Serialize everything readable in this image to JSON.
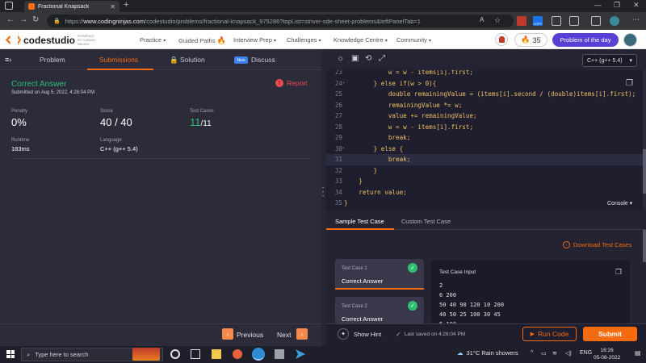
{
  "browser": {
    "tab_title": "Fractional Knapsack",
    "url_prefix": "https://",
    "url_host": "www.codingninjas.com",
    "url_path": "/codestudio/problems/fractional-knapsack_975286?topList=striver-sde-sheet-problems&leftPanelTab=1",
    "copy_badge": "COPY"
  },
  "site": {
    "logo_name": "codestudio",
    "logo_by": "POWERED BY CODING NINJAS",
    "menu": [
      "Practice",
      "Guided Paths",
      "Interview Prep",
      "Challenges",
      "Knowledge Centre",
      "Community"
    ],
    "streak_count": "35",
    "potd_label": "Problem of the day"
  },
  "left_tabs": {
    "problem": "Problem",
    "submissions": "Submissions",
    "solution": "Solution",
    "new_badge": "New",
    "discuss": "Discuss"
  },
  "result": {
    "status": "Correct Answer",
    "submitted": "Submitted on Aug 5, 2022, 4:26:04 PM",
    "report": "Report",
    "penalty_label": "Penalty",
    "penalty_value": "0%",
    "score_label": "Score",
    "score_value": "40 / 40",
    "testcases_label": "Test Cases",
    "testcases_passed": "11",
    "testcases_total": "/11",
    "runtime_label": "Runtime",
    "runtime_value": "183ms",
    "language_label": "Language",
    "language_value": "C++ (g++ 5.4)"
  },
  "pager": {
    "previous": "Previous",
    "next": "Next"
  },
  "editor": {
    "language": "C++ (g++ 5.4)",
    "lines": [
      {
        "n": "23",
        "fold": "",
        "code": "            w = w - items[i].first;"
      },
      {
        "n": "24",
        "fold": "▾",
        "code": "        } else if(w > 0){"
      },
      {
        "n": "25",
        "fold": "",
        "code": "            double remainingValue = (items[i].second / (double)items[i].first);"
      },
      {
        "n": "26",
        "fold": "",
        "code": "            remainingValue *= w;"
      },
      {
        "n": "27",
        "fold": "",
        "code": "            value += remainingValue;"
      },
      {
        "n": "28",
        "fold": "",
        "code": "            w = w - items[i].first;"
      },
      {
        "n": "29",
        "fold": "",
        "code": "            break;"
      },
      {
        "n": "30",
        "fold": "▾",
        "code": "        } else {"
      },
      {
        "n": "31",
        "fold": "",
        "code": "            break;"
      },
      {
        "n": "32",
        "fold": "",
        "code": "        }"
      },
      {
        "n": "33",
        "fold": "",
        "code": "    }"
      },
      {
        "n": "34",
        "fold": "",
        "code": "    return value;"
      },
      {
        "n": "35",
        "fold": "",
        "code": "}"
      }
    ],
    "console_label": "Console"
  },
  "console": {
    "tab_sample": "Sample Test Case",
    "tab_custom": "Custom Test Case",
    "download": "Download Test Cases",
    "case1_label": "Test Case 1",
    "case1_result": "Correct Answer",
    "case2_label": "Test Case 2",
    "case2_result": "Correct Answer",
    "input_heading": "Test Case Input",
    "input_lines": [
      "2",
      "6 200",
      "50 40 90 120 10 200",
      "40 50 25 100 30 45",
      "5 100"
    ]
  },
  "bottom_bar": {
    "show_hint": "Show Hint",
    "last_saved": "Last saved on 4:26:04 PM",
    "run_code": "Run Code",
    "submit": "Submit"
  },
  "taskbar": {
    "search_placeholder": "Type here to search",
    "weather": "31°C  Rain showers",
    "lang": "ENG",
    "time": "16:26",
    "date": "05-08-2022"
  }
}
